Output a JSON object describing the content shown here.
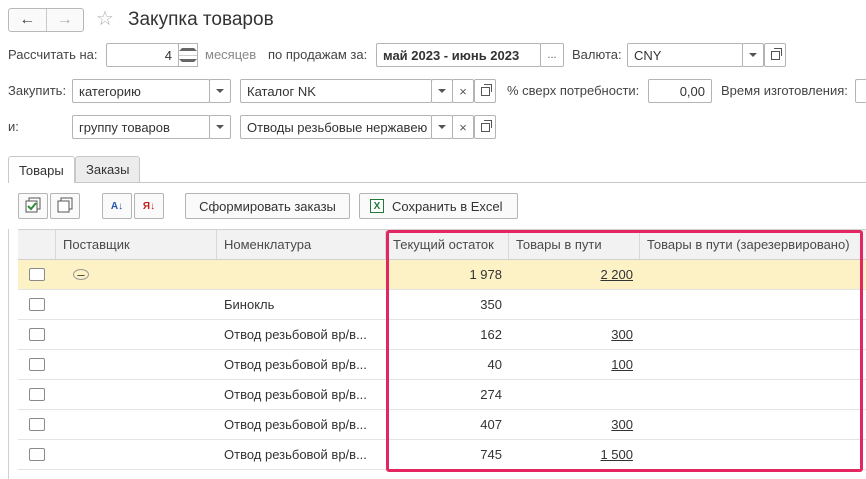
{
  "header": {
    "back_icon": "arrow-left-icon",
    "forward_icon": "arrow-right-icon",
    "favorite_icon": "star-icon",
    "title": "Закупка товаров"
  },
  "form": {
    "calc_label": "Рассчитать на:",
    "months_value": "4",
    "months_unit": "месяцев",
    "sales_label": "по продажам за:",
    "period_value": "май 2023 - июнь 2023",
    "period_button": "...",
    "currency_label": "Валюта:",
    "currency_value": "CNY",
    "purchase_label": "Закупить:",
    "purchase_type_value": "категорию",
    "catalog_value": "Каталог NK",
    "clear_glyph": "×",
    "percent_label": "% сверх потребности:",
    "percent_value": "0,00",
    "manufacture_label": "Время изготовления:",
    "and_label": "и:",
    "and_type_value": "группу товаров",
    "group_value": "Отводы резьбовые нержавею"
  },
  "tabs": [
    {
      "label": "Товары",
      "active": true
    },
    {
      "label": "Заказы",
      "active": false
    }
  ],
  "toolbar": {
    "check_all_icon": "check-all-icon",
    "uncheck_all_icon": "copy-icon",
    "sort_asc_icon": "sort-asc-icon",
    "sort_desc_icon": "sort-desc-icon",
    "sort_asc_glyph": "А↓",
    "sort_desc_glyph": "Я↓",
    "create_orders_label": "Сформировать заказы",
    "save_excel_label": "Сохранить в Excel",
    "excel_glyph": "X"
  },
  "table": {
    "columns": [
      "Поставщик",
      "Номенклатура",
      "Текущий остаток",
      "Товары в пути",
      "Товары в пути (зарезервировано)"
    ],
    "group_row": {
      "stock": "1 978",
      "transit": "2 200"
    },
    "rows": [
      {
        "supplier": "",
        "item": "Бинокль",
        "stock": "350",
        "transit": ""
      },
      {
        "supplier": "",
        "item": "Отвод резьбовой вр/в...",
        "stock": "162",
        "transit": "300"
      },
      {
        "supplier": "",
        "item": "Отвод резьбовой вр/в...",
        "stock": "40",
        "transit": "100"
      },
      {
        "supplier": "",
        "item": "Отвод резьбовой вр/в...",
        "stock": "274",
        "transit": ""
      },
      {
        "supplier": "",
        "item": "Отвод резьбовой вр/в...",
        "stock": "407",
        "transit": "300"
      },
      {
        "supplier": "",
        "item": "Отвод резьбовой вр/в...",
        "stock": "745",
        "transit": "1 500"
      }
    ]
  },
  "colors": {
    "highlight": "#e32661",
    "group_row_bg": "#fdf1c6",
    "header_bg": "#f2f2f2"
  }
}
